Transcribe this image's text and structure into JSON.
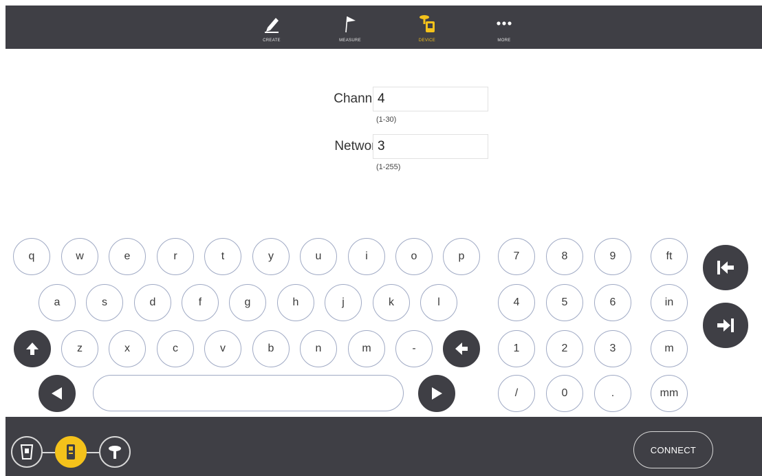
{
  "topnav": {
    "items": [
      {
        "label": "CREATE",
        "icon": "pencil-icon"
      },
      {
        "label": "MEASURE",
        "icon": "flag-icon"
      },
      {
        "label": "DEVICE",
        "icon": "device-icon",
        "active": true
      },
      {
        "label": "MORE",
        "icon": "more-icon"
      }
    ]
  },
  "form": {
    "channel": {
      "label": "Channel",
      "value": "4",
      "hint": "(1-30)"
    },
    "network": {
      "label": "Network",
      "value": "3",
      "hint": "(1-255)"
    }
  },
  "keyboard": {
    "row1": [
      "q",
      "w",
      "e",
      "r",
      "t",
      "y",
      "u",
      "i",
      "o",
      "p"
    ],
    "row2": [
      "a",
      "s",
      "d",
      "f",
      "g",
      "h",
      "j",
      "k",
      "l"
    ],
    "row3": [
      "z",
      "x",
      "c",
      "v",
      "b",
      "n",
      "m",
      "-"
    ],
    "numpad": [
      [
        "7",
        "8",
        "9",
        "ft"
      ],
      [
        "4",
        "5",
        "6",
        "in"
      ],
      [
        "1",
        "2",
        "3",
        "m"
      ],
      [
        "/",
        "0",
        ".",
        "mm"
      ]
    ]
  },
  "bottombar": {
    "connect_label": "CONNECT"
  },
  "colors": {
    "bar": "#3f3f45",
    "accent": "#f4c21b",
    "key_border": "#9fa9c4"
  }
}
